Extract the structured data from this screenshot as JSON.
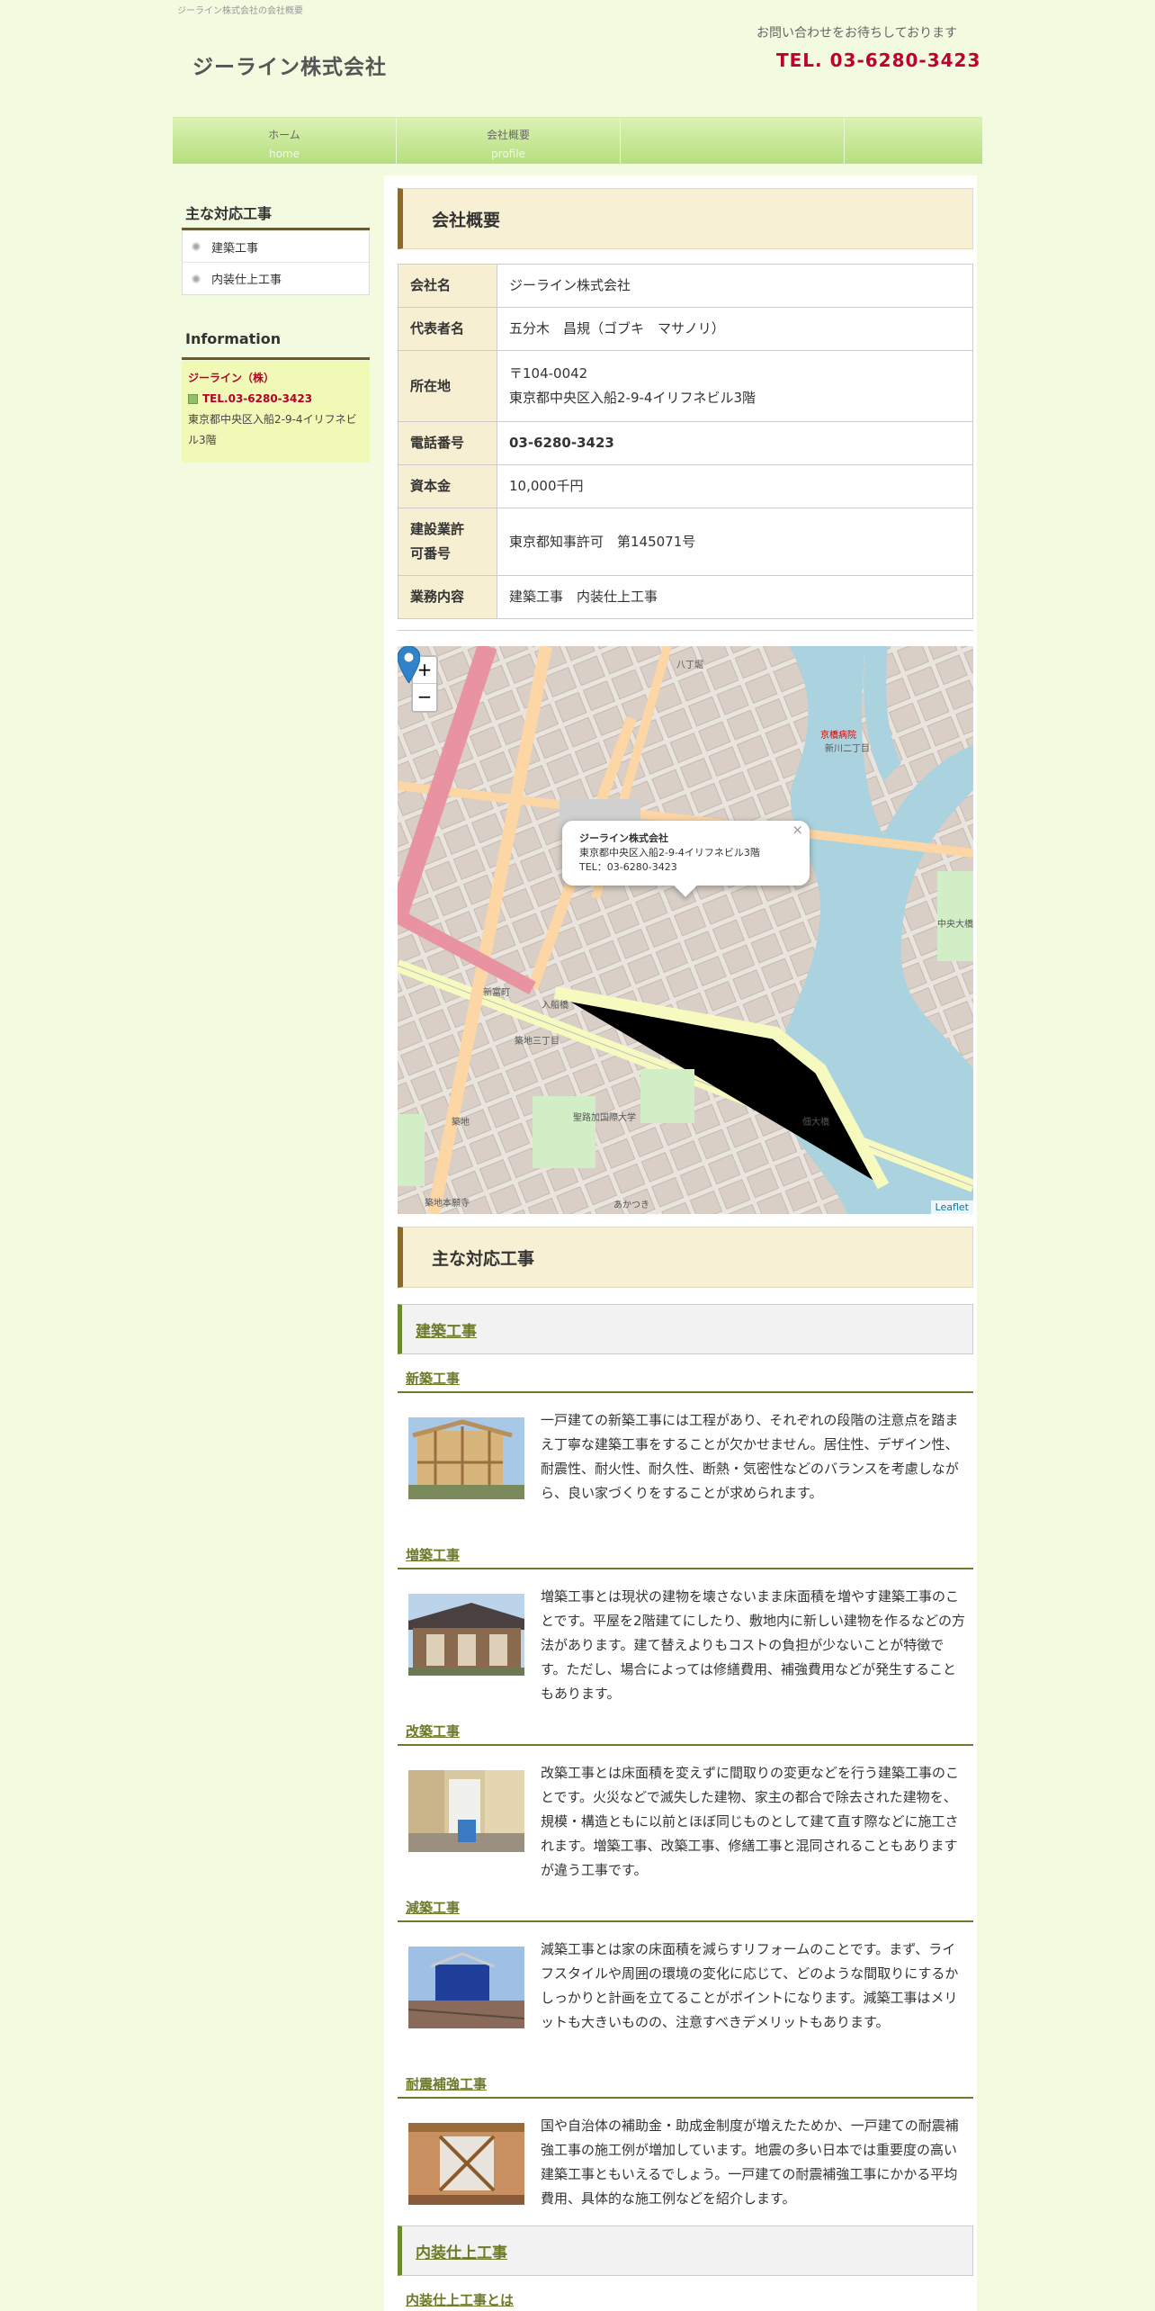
{
  "header": {
    "tagline": "ジーライン株式会社の会社概要",
    "site_title": "ジーライン株式会社",
    "contact_note": "お問い合わせをお待ちしております",
    "tel": "TEL. 03-6280-3423"
  },
  "nav": [
    {
      "label": "ホーム",
      "sub": "home"
    },
    {
      "label": "会社概要",
      "sub": "profile"
    },
    {
      "label": "",
      "sub": ""
    }
  ],
  "sidebar": {
    "works_title": "主な対応工事",
    "works_items": [
      "建築工事",
      "内装仕上工事"
    ],
    "info_title": "Information",
    "info_name": "ジーライン（株）",
    "info_tel": "TEL.03-6280-3423",
    "info_addr": "東京都中央区入船2-9-4イリフネビル3階"
  },
  "profile": {
    "heading": "会社概要",
    "rows": [
      {
        "label": "会社名",
        "value": "ジーライン株式会社"
      },
      {
        "label": "代表者名",
        "value": "五分木　昌規（ゴブキ　マサノリ）"
      },
      {
        "label": "所在地",
        "value": "〒104-0042",
        "value2": "東京都中央区入船2-9-4イリフネビル3階"
      },
      {
        "label": "電話番号",
        "value": "03-6280-3423"
      },
      {
        "label": "資本金",
        "value": "10,000千円"
      },
      {
        "label": "建設業許",
        "label2": "可番号",
        "value": "東京都知事許可　第145071号"
      },
      {
        "label": "業務内容",
        "value": "建築工事　内装仕上工事"
      }
    ]
  },
  "map": {
    "popup_name": "ジーライン株式会社",
    "popup_addr": "東京都中央区入船2-9-4イリフネビル3階",
    "popup_tel": "TEL：03-6280-3423",
    "zoom_in": "+",
    "zoom_out": "−",
    "attribution": "Leaflet",
    "labels": [
      "八丁堀",
      "新川二丁目",
      "新富町",
      "築地三丁目",
      "佃大橋",
      "中央大橋",
      "築地",
      "あかつき",
      "入船橋",
      "京橋病院",
      "聖路加国際大学",
      "築地本願寺"
    ]
  },
  "works": {
    "heading": "主な対応工事",
    "section1_title": "建築工事",
    "items": [
      {
        "title": "新築工事",
        "text": "一戸建ての新築工事には工程があり、それぞれの段階の注意点を踏まえ丁寧な建築工事をすることが欠かせません。居住性、デザイン性、耐震性、耐火性、耐久性、断熱・気密性などのバランスを考慮しながら、良い家づくりをすることが求められます。"
      },
      {
        "title": "増築工事",
        "text": "増築工事とは現状の建物を壊さないまま床面積を増やす建築工事のことです。平屋を2階建てにしたり、敷地内に新しい建物を作るなどの方法があります。建て替えよりもコストの負担が少ないことが特徴です。ただし、場合によっては修繕費用、補強費用などが発生することもあります。"
      },
      {
        "title": "改築工事",
        "text": "改築工事とは床面積を変えずに間取りの変更などを行う建築工事のことです。火災などで滅失した建物、家主の都合で除去された建物を、規模・構造ともに以前とほぼ同じものとして建て直す際などに施工されます。増築工事、改築工事、修繕工事と混同されることもありますが違う工事です。"
      },
      {
        "title": "減築工事",
        "text": "減築工事とは家の床面積を減らすリフォームのことです。まず、ライフスタイルや周囲の環境の変化に応じて、どのような間取りにするかしっかりと計画を立てることがポイントになります。減築工事はメリットも大きいものの、注意すべきデメリットもあります。"
      },
      {
        "title": "耐震補強工事",
        "text": "国や自治体の補助金・助成金制度が増えたためか、一戸建ての耐震補強工事の施工例が増加しています。地震の多い日本では重要度の高い建築工事ともいえるでしょう。一戸建ての耐震補強工事にかかる平均費用、具体的な施工例などを紹介します。"
      }
    ],
    "section2_title": "内装仕上工事",
    "section2_sub": "内装仕上工事とは"
  }
}
